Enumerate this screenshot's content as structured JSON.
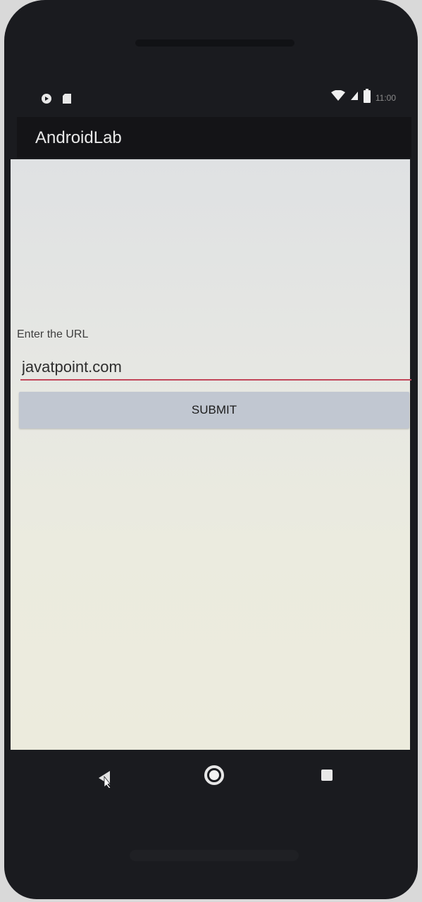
{
  "status_bar": {
    "time": "11:00",
    "icons": [
      "notification-icon",
      "sd-card-icon",
      "wifi-icon",
      "cellular-icon",
      "battery-icon"
    ]
  },
  "app_bar": {
    "title": "AndroidLab"
  },
  "form": {
    "label": "Enter the URL",
    "url_value": "javatpoint.com",
    "submit_label": "SUBMIT"
  },
  "nav_bar": {
    "icons": [
      "back-icon",
      "home-icon",
      "recents-icon"
    ]
  },
  "colors": {
    "app_bar": "#141417",
    "screen_bg": "#e6e7e3",
    "input_underline": "#c2475a",
    "button_bg": "#c1c7d1"
  }
}
